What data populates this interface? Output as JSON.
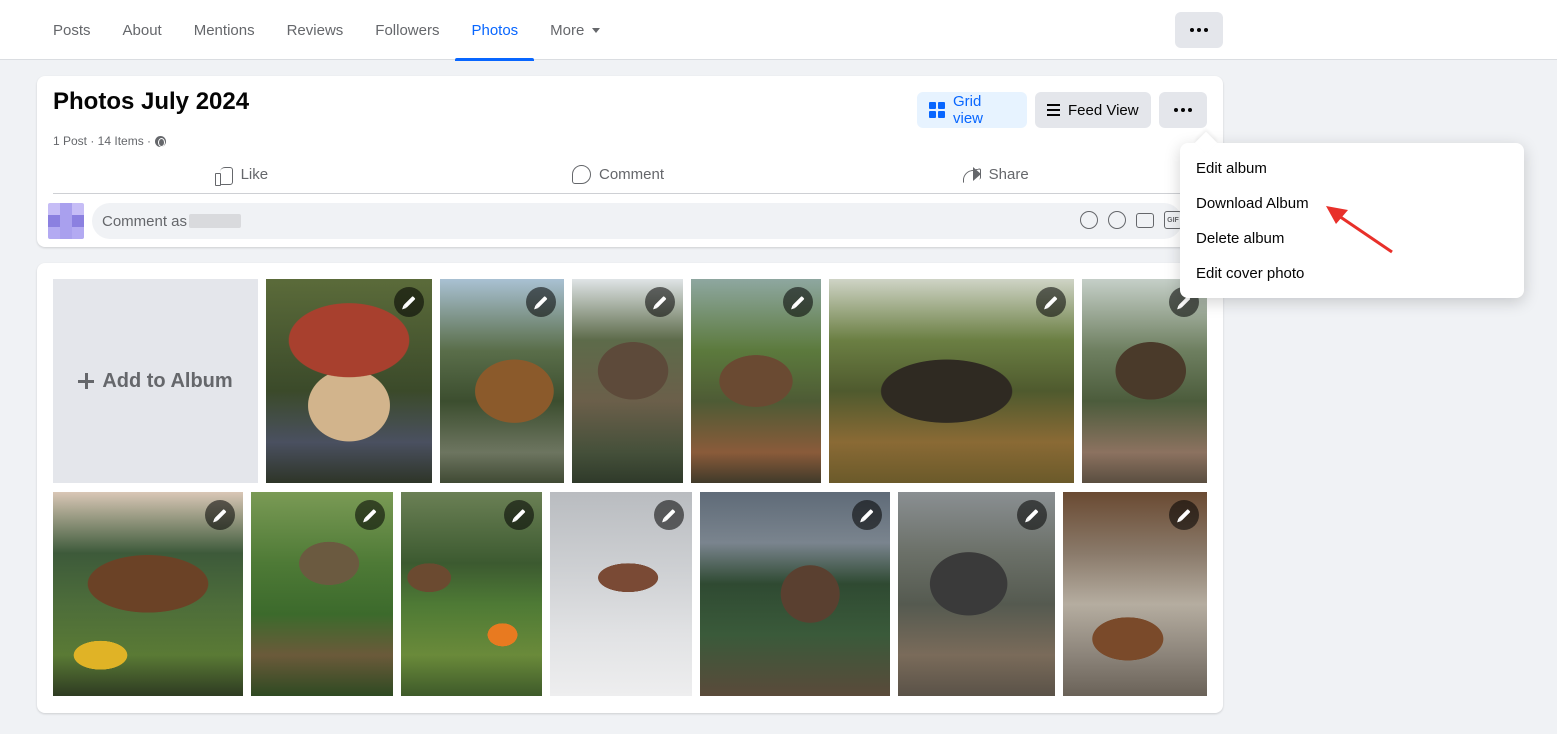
{
  "tabs": [
    {
      "label": "Posts"
    },
    {
      "label": "About"
    },
    {
      "label": "Mentions"
    },
    {
      "label": "Reviews"
    },
    {
      "label": "Followers"
    },
    {
      "label": "Photos",
      "active": true
    },
    {
      "label": "More"
    }
  ],
  "album": {
    "title": "Photos July 2024",
    "meta": "1 Post · 14 Items ·",
    "grid_view_label": "Grid view",
    "feed_view_label": "Feed View"
  },
  "actions": {
    "like": "Like",
    "comment": "Comment",
    "share": "Share"
  },
  "comment_box": {
    "placeholder": "Comment as"
  },
  "dropdown": {
    "items": [
      {
        "label": "Edit album"
      },
      {
        "label": "Download Album"
      },
      {
        "label": "Delete album"
      },
      {
        "label": "Edit cover photo"
      }
    ]
  },
  "grid": {
    "add_label": "Add to Album"
  },
  "colors": {
    "accent": "#0866ff",
    "annotation_arrow": "#e8302a"
  }
}
